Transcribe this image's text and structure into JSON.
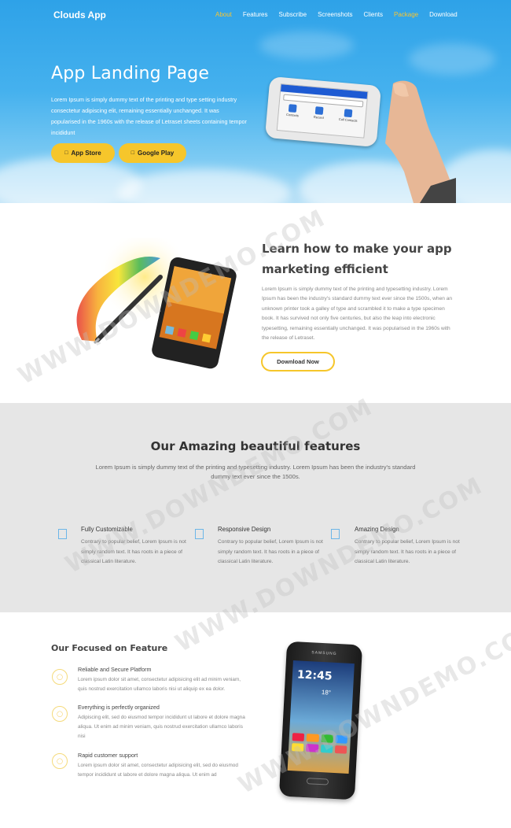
{
  "nav": {
    "brand": "Clouds App",
    "items": [
      {
        "label": "About",
        "active": true
      },
      {
        "label": "Features",
        "active": false
      },
      {
        "label": "Subscribe",
        "active": false
      },
      {
        "label": "Screenshots",
        "active": false
      },
      {
        "label": "Clients",
        "active": false
      },
      {
        "label": "Package",
        "active": true
      },
      {
        "label": "Download",
        "active": false
      }
    ]
  },
  "hero": {
    "title": "App Landing Page",
    "text": "Lorem Ipsum is simply dummy text of the printing and type setting industry consectetur adipiscing elit, remaining essentially unchanged. It was popularised in the 1960s with the release of Letraset sheets containing tempor incididunt",
    "btn_appstore": "App Store",
    "btn_googleplay": "Google Play",
    "phone_apps": [
      "Contacts",
      "Record",
      "Call Contacts"
    ]
  },
  "section2": {
    "title": "Learn how to make your app marketing efficient",
    "text": "Lorem Ipsum is simply dummy text of the printing and typesetting industry. Lorem Ipsum has been the industry's standard dummy text ever since the 1500s, when an unknown printer took a galley of type and scrambled it to make a type specimen book. It has survived not only five centuries, but also the leap into electronic typesetting, remaining essentially unchanged. It was popularised in the 1960s with the release of Letraset.",
    "btn": "Download Now"
  },
  "features": {
    "title": "Our Amazing beautiful features",
    "subtitle": "Lorem Ipsum is simply dummy text of the printing and typesetting industry. Lorem Ipsum has been the industry's standard dummy text ever since the 1500s.",
    "items": [
      {
        "title": "Fully Customizable",
        "text": "Contrary to popular belief, Lorem Ipsum is not simply random text. It has roots in a piece of classical Latin literature."
      },
      {
        "title": "Responsive Design",
        "text": "Contrary to popular belief, Lorem Ipsum is not simply random text. It has roots in a piece of classical Latin literature."
      },
      {
        "title": "Amazing Design",
        "text": "Contrary to popular belief, Lorem Ipsum is not simply random text. It has roots in a piece of classical Latin literature."
      }
    ]
  },
  "focused": {
    "title": "Our Focused on Feature",
    "items": [
      {
        "title": "Reliable and Secure Platform",
        "text": "Lorem ipsum dolor sit amet, consectetur adipisicing elit ad minim veniam, quis nostrud exercitation ullamco laboris nisi ut aliquip ex ea dolor."
      },
      {
        "title": "Everything is perfectly organized",
        "text": "Adipiscing elit, sed do eiusmod tempor incididunt ut labore et dolore magna aliqua. Ut enim ad minim veniam, quis nostrud exercitation ullamco laboris nisi"
      },
      {
        "title": "Rapid customer support",
        "text": "Lorem ipsum dolor sit amet, consectetur adipisicing elit, sed do eiusmod tempor incididunt ut labore et dolore magna aliqua. Ut enim ad"
      }
    ],
    "phone": {
      "brand": "SAMSUNG",
      "time": "12:45",
      "weather_temp": "18°"
    }
  },
  "watermark": "WWW.DOWNDEMO.COM",
  "colors": {
    "accent": "#f6c62b",
    "hero_blue": "#2ea2e8",
    "feature_bg": "#e6e6e6",
    "icon_blue": "#6cb6e8"
  }
}
